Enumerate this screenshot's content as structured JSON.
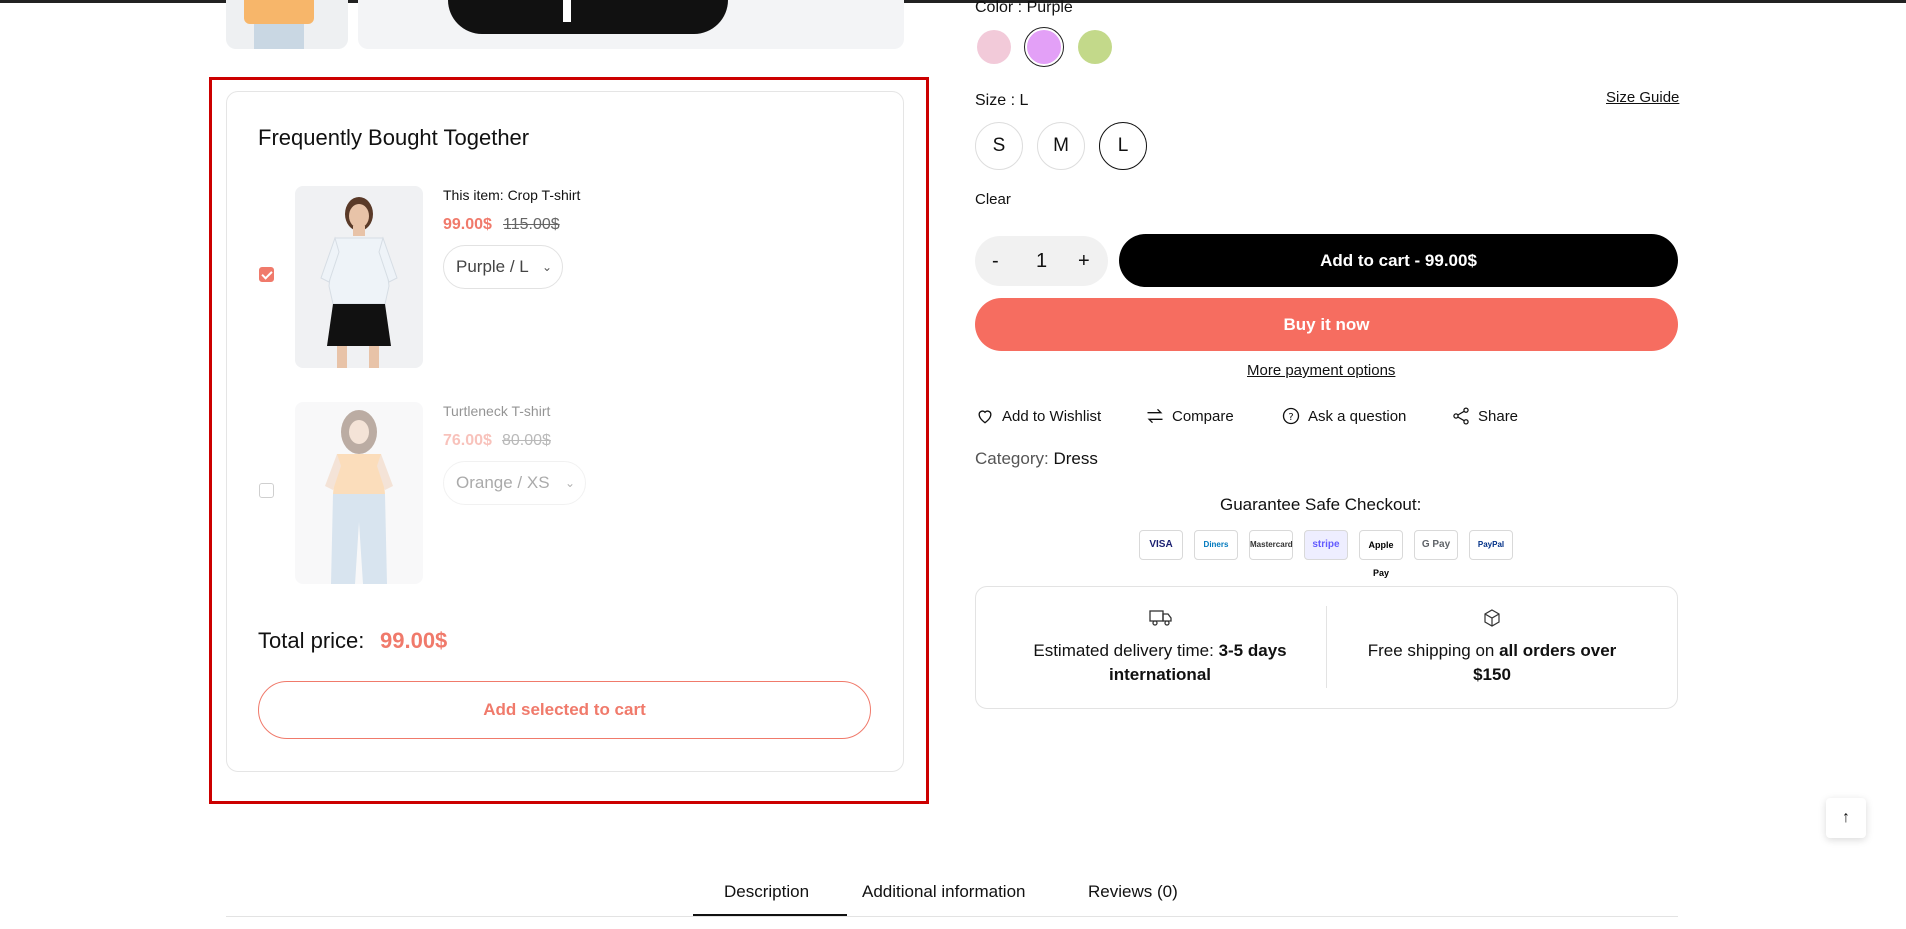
{
  "colors": {
    "accent": "#f07a6b",
    "primary_button": "#000000",
    "buy_now": "#f66d60",
    "swatch_pink": "#f2cad9",
    "swatch_purple": "#e3a0f7",
    "swatch_green": "#c3d98a"
  },
  "fbt": {
    "title": "Frequently Bought Together",
    "items": [
      {
        "checked": true,
        "name": "This item: Crop T-shirt",
        "sale_price": "99.00$",
        "old_price": "115.00$",
        "variant": "Purple / L"
      },
      {
        "checked": false,
        "name": "Turtleneck T-shirt",
        "sale_price": "76.00$",
        "old_price": "80.00$",
        "variant": "Orange / XS"
      }
    ],
    "total_label": "Total price:",
    "total_value": "99.00$",
    "add_selected_label": "Add selected to cart"
  },
  "product": {
    "color_label": "Color :",
    "color_value": "Purple",
    "size_label": "Size :",
    "size_value": "L",
    "size_guide": "Size Guide",
    "sizes": [
      "S",
      "M",
      "L"
    ],
    "clear_label": "Clear",
    "qty_minus": "-",
    "quantity": "1",
    "qty_plus": "+",
    "add_to_cart": "Add to cart - 99.00$",
    "buy_now": "Buy it now",
    "more_payment": "More payment options",
    "actions": [
      "Add to Wishlist",
      "Compare",
      "Ask a question",
      "Share"
    ],
    "category_label": "Category:",
    "category_value": "Dress",
    "guarantee": "Guarantee Safe Checkout:",
    "payments": [
      "VISA",
      "Diners",
      "Mastercard",
      "stripe",
      "Apple Pay",
      "G Pay",
      "PayPal"
    ],
    "delivery": {
      "prefix": "Estimated delivery time:",
      "bold1": "3-5 days",
      "bold2": "international"
    },
    "shipping": {
      "prefix": "Free shipping on",
      "bold1": "all orders over",
      "bold2": "$150"
    }
  },
  "tabs": [
    "Description",
    "Additional information",
    "Reviews (0)"
  ]
}
